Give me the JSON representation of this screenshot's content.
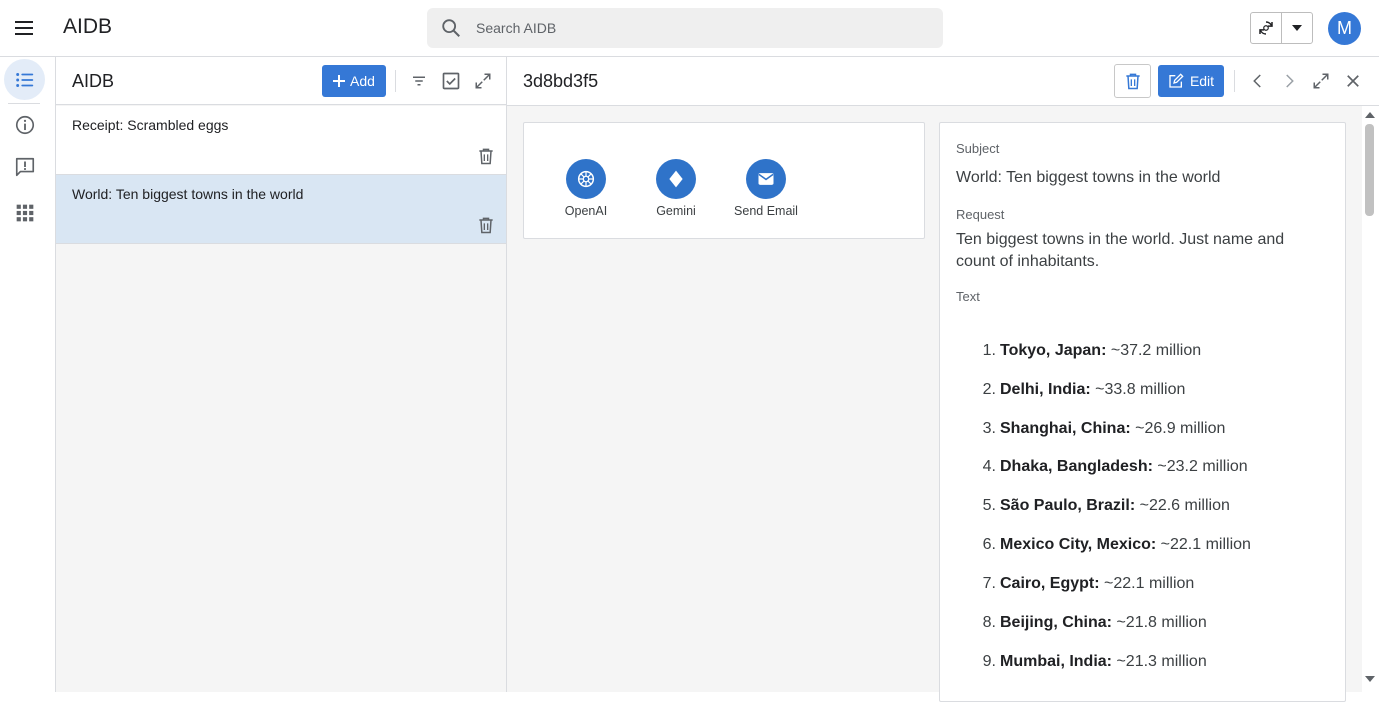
{
  "app": {
    "title": "AIDB",
    "avatar_letter": "M",
    "accent": "#3578d6"
  },
  "search": {
    "placeholder": "Search AIDB"
  },
  "rail": {
    "items": [
      "list-icon",
      "info-icon",
      "feedback-icon",
      "apps-grid-icon"
    ]
  },
  "list": {
    "title": "AIDB",
    "add_label": "Add",
    "items": [
      {
        "label": "Receipt: Scrambled eggs",
        "selected": false
      },
      {
        "label": "World: Ten biggest towns in the world",
        "selected": true
      }
    ]
  },
  "detail": {
    "title": "3d8bd3f5",
    "edit_label": "Edit",
    "actions": [
      {
        "label": "OpenAI",
        "icon": "openai-icon"
      },
      {
        "label": "Gemini",
        "icon": "gemini-icon"
      },
      {
        "label": "Send Email",
        "icon": "email-icon"
      }
    ],
    "subject_label": "Subject",
    "subject": "World: Ten biggest towns in the world",
    "request_label": "Request",
    "request": "Ten biggest towns in the world. Just name and count of inhabitants.",
    "text_label": "Text",
    "cities": [
      {
        "num": "1.",
        "name": "Tokyo, Japan:",
        "count": "~37.2 million"
      },
      {
        "num": "2.",
        "name": "Delhi, India:",
        "count": "~33.8 million"
      },
      {
        "num": "3.",
        "name": "Shanghai, China:",
        "count": "~26.9 million"
      },
      {
        "num": "4.",
        "name": "Dhaka, Bangladesh:",
        "count": "~23.2 million"
      },
      {
        "num": "5.",
        "name": "São Paulo, Brazil:",
        "count": "~22.6 million"
      },
      {
        "num": "6.",
        "name": "Mexico City, Mexico:",
        "count": "~22.1 million"
      },
      {
        "num": "7.",
        "name": "Cairo, Egypt:",
        "count": "~22.1 million"
      },
      {
        "num": "8.",
        "name": "Beijing, China:",
        "count": "~21.8 million"
      },
      {
        "num": "9.",
        "name": "Mumbai, India:",
        "count": "~21.3 million"
      }
    ]
  }
}
